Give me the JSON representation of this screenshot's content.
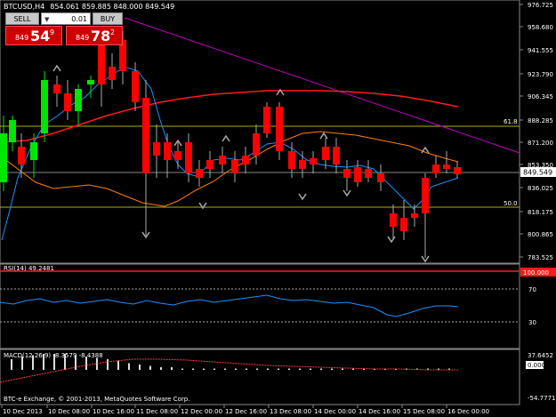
{
  "window": {
    "symbol_title": "BTCUSD,H4",
    "ohlc": "854.061 859.885 848.000 849.549",
    "copyright": "BTC-e Exchange, © 2001-2013, MetaQuotes Software Corp."
  },
  "trade_panel": {
    "sell_label": "SELL",
    "buy_label": "BUY",
    "lot": "0.01",
    "sell_price_prefix": "849",
    "sell_price_big": "54",
    "sell_price_sup": "9",
    "buy_price_prefix": "849",
    "buy_price_big": "78",
    "buy_price_sup": "2"
  },
  "price_axis": {
    "labels": [
      "976.725",
      "958.680",
      "941.555",
      "923.790",
      "906.345",
      "888.285",
      "871.200",
      "853.350",
      "849.549",
      "836.025",
      "818.175",
      "800.865",
      "783.525"
    ],
    "current_price": "849.549"
  },
  "fibo": {
    "level_618": "61.8",
    "level_500": "50.0"
  },
  "rsi": {
    "title": "RSI(14) 49.2481",
    "levels": [
      "70",
      "30"
    ],
    "current_tag": "100.000"
  },
  "macd": {
    "title": "MACD(12,26,9) -8.3579 -8.4388",
    "scale_top": "37.6452",
    "scale_mid": "0.000",
    "scale_bottom": "-54.7771"
  },
  "time_axis": {
    "labels": [
      "10 Dec 2013",
      "10 Dec 08:00",
      "10 Dec 16:00",
      "11 Dec 08:00",
      "12 Dec 00:00",
      "12 Dec 16:00",
      "13 Dec 08:00",
      "14 Dec 00:00",
      "14 Dec 16:00",
      "15 Dec 08:00",
      "16 Dec 00:00"
    ]
  },
  "colors": {
    "bull": "#00e600",
    "bear": "#ff0000",
    "ma_red": "#ff0000",
    "ma_orange": "#ff8000",
    "ma_blue": "#1e90ff",
    "trendline": "#c000c0",
    "fibo": "#c0c000"
  },
  "chart_data": {
    "type": "candlestick",
    "series": [
      {
        "name": "BTCUSD,H4"
      }
    ],
    "last": {
      "open": 854.061,
      "high": 859.885,
      "low": 848.0,
      "close": 849.549
    }
  }
}
